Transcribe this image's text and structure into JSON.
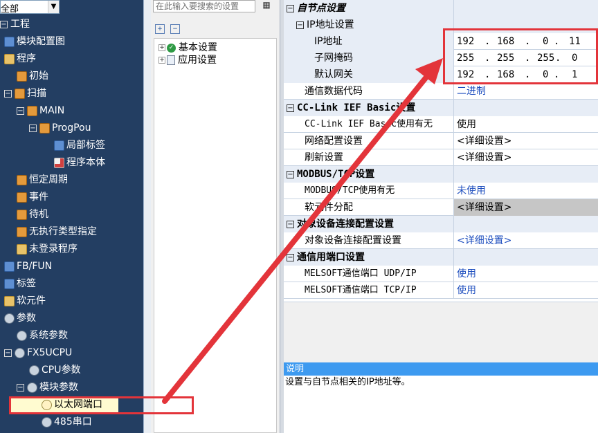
{
  "left_tree": {
    "combo_value": "全部",
    "items": [
      {
        "label": "工程"
      },
      {
        "label": "模块配置图"
      },
      {
        "label": "程序"
      },
      {
        "label": "初始"
      },
      {
        "label": "扫描"
      },
      {
        "label": "MAIN"
      },
      {
        "label": "ProgPou"
      },
      {
        "label": "局部标签"
      },
      {
        "label": "程序本体"
      },
      {
        "label": "恒定周期"
      },
      {
        "label": "事件"
      },
      {
        "label": "待机"
      },
      {
        "label": "无执行类型指定"
      },
      {
        "label": "未登录程序"
      },
      {
        "label": "FB/FUN"
      },
      {
        "label": "标签"
      },
      {
        "label": "软元件"
      },
      {
        "label": "参数"
      },
      {
        "label": "系统参数"
      },
      {
        "label": "FX5UCPU"
      },
      {
        "label": "CPU参数"
      },
      {
        "label": "模块参数"
      },
      {
        "label": "以太网端口"
      },
      {
        "label": "485串口"
      }
    ]
  },
  "middle": {
    "search_placeholder": "在此输入要搜索的设置",
    "items": [
      {
        "label": "基本设置"
      },
      {
        "label": "应用设置"
      }
    ]
  },
  "grid": {
    "own_node": "自节点设置",
    "ip_group": "IP地址设置",
    "ip_address_label": "IP地址",
    "ip_address": [
      "192",
      ".",
      "168",
      ".",
      "0",
      ".",
      "11"
    ],
    "subnet_label": "子网掩码",
    "subnet": [
      "255",
      ".",
      "255",
      ".",
      "255",
      ".",
      "0"
    ],
    "gateway_label": "默认网关",
    "gateway": [
      "192",
      ".",
      "168",
      ".",
      "0",
      ".",
      "1"
    ],
    "data_code_label": "通信数据代码",
    "data_code_value": "二进制",
    "cclink_cat": "CC-Link IEF Basic设置",
    "cclink_use_label": "CC-Link IEF Basic使用有无",
    "cclink_use_value": "使用",
    "net_config_label": "网络配置设置",
    "net_config_value": "<详细设置>",
    "refresh_label": "刷新设置",
    "refresh_value": "<详细设置>",
    "modbus_cat": "MODBUS/TCP设置",
    "modbus_use_label": "MODBUS/TCP使用有无",
    "modbus_use_value": "未使用",
    "device_assign_label": "软元件分配",
    "device_assign_value": "<详细设置>",
    "target_cat": "对象设备连接配置设置",
    "target_label": "对象设备连接配置设置",
    "target_value": "<详细设置>",
    "port_cat": "通信用端口设置",
    "udp_label": "MELSOFT通信端口 UDP/IP",
    "udp_value": "使用",
    "tcp_label": "MELSOFT通信端口 TCP/IP",
    "tcp_value": "使用"
  },
  "description": {
    "title": "说明",
    "text": "设置与自节点相关的IP地址等。"
  },
  "colors": {
    "tree_bg": "#233e62",
    "highlight_red": "#e3343a",
    "link_blue": "#1f4fbf",
    "header_blue": "#3d9af0"
  }
}
